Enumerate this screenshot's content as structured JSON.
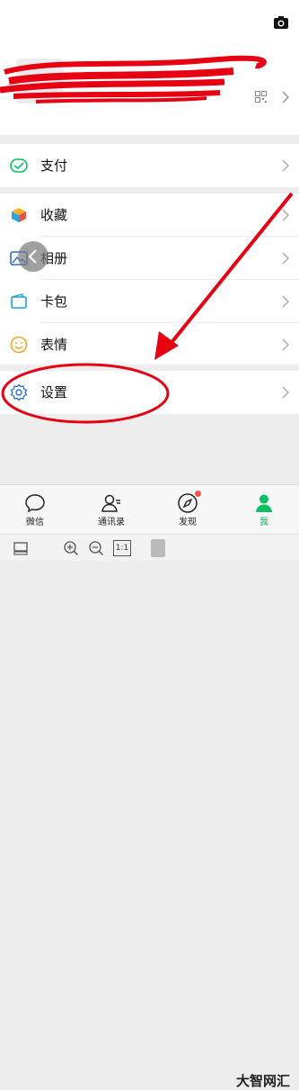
{
  "menu": {
    "pay": "支付",
    "favorites": "收藏",
    "album": "相册",
    "cards": "卡包",
    "stickers": "表情",
    "settings": "设置"
  },
  "tabs": [
    {
      "label": "微信",
      "icon": "chat-icon"
    },
    {
      "label": "通讯录",
      "icon": "contacts-icon"
    },
    {
      "label": "发现",
      "icon": "compass-icon"
    },
    {
      "label": "我",
      "icon": "me-icon"
    }
  ],
  "watermark": "大智网汇",
  "toolbar_zoom_label": "1:1",
  "colors": {
    "accent": "#07c160",
    "annotation_red": "#e60012"
  }
}
